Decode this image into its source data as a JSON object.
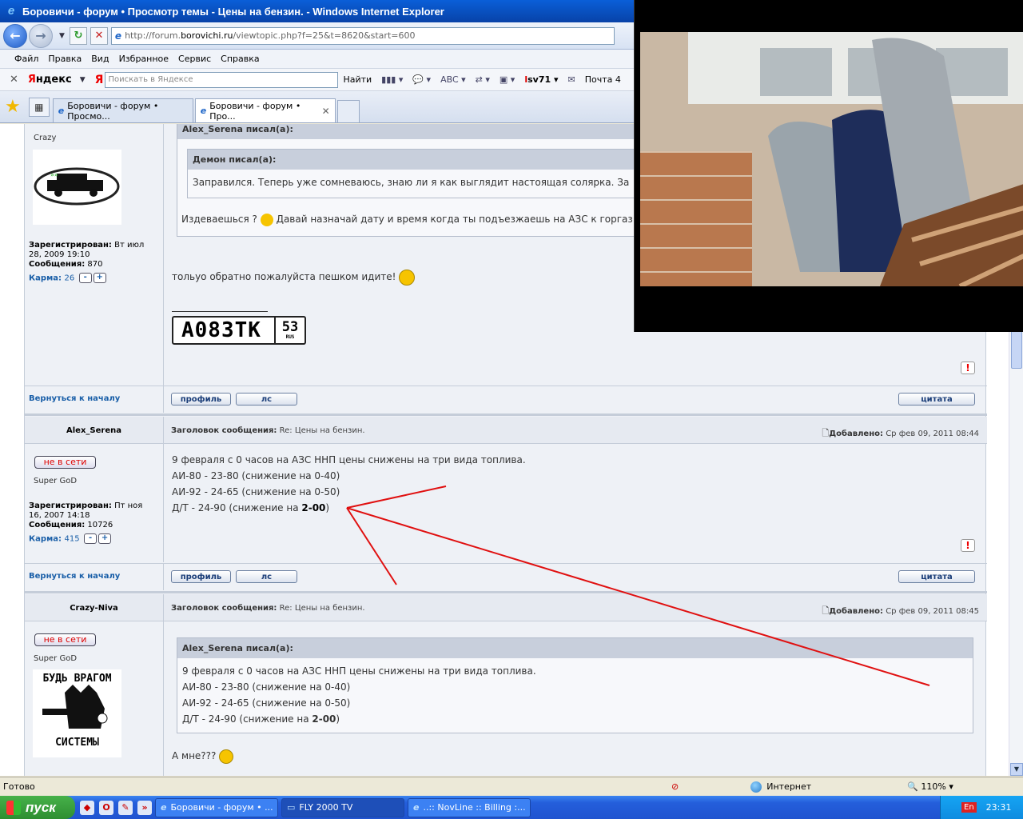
{
  "window": {
    "title": "Боровичи - форум • Просмотр темы - Цены на бензин. - Windows Internet Explorer"
  },
  "address": {
    "prefix": "http://forum.",
    "domain": "borovichi.ru",
    "path": "/viewtopic.php?f=25&t=8620&start=600"
  },
  "menu": [
    "Файл",
    "Правка",
    "Вид",
    "Избранное",
    "Сервис",
    "Справка"
  ],
  "yandex": {
    "logo_y": "Я",
    "logo_rest": "ндекс",
    "search_placeholder": "Поискать в Яндексе",
    "find_label": "Найти",
    "user_first": "l",
    "user_rest": "sv71",
    "mail_label": "Почта 4"
  },
  "tabs": [
    {
      "label": "Боровичи - форум • Просмо..."
    },
    {
      "label": "Боровичи - форум • Про..."
    }
  ],
  "posts": [
    {
      "rank": "Crazy",
      "registered_label": "Зарегистрирован:",
      "registered": "Вт июл 28, 2009 19:10",
      "messages_label": "Сообщения:",
      "messages": "870",
      "karma_label": "Карма:",
      "karma": "26",
      "outer_quote_head": "Alex_Serena писал(а):",
      "inner_quote_head": "Демон писал(а):",
      "inner_quote_text": "Заправился. Теперь уже сомневаюсь, знаю ли я как выглядит настоящая солярка. За",
      "outer_quote_text_a": "Издеваешься ?",
      "outer_quote_text_b": "Давай назначай дату и время когда ты подъезжаешь на АЗС к горгаз",
      "body": "тольуо обратно пожалуйста пешком идите!",
      "plate_main": "А083ТК",
      "plate_region": "53",
      "plate_rus": "RUS"
    },
    {
      "author": "Alex_Serena",
      "subject_label": "Заголовок сообщения:",
      "subject": "Re: Цены на бензин.",
      "posted_label": "Добавлено:",
      "posted": "Ср фев 09, 2011 08:44",
      "status": "не в сети",
      "rank": "Super GoD",
      "registered_label": "Зарегистрирован:",
      "registered": "Пт ноя 16, 2007 14:18",
      "messages_label": "Сообщения:",
      "messages": "10726",
      "karma_label": "Карма:",
      "karma": "415",
      "lines": [
        "9 февраля с 0 часов на АЗС ННП цены снижены на три вида топлива.",
        "АИ-80 - 23-80 (снижение на 0-40)",
        "АИ-92 - 24-65 (снижение на 0-50)"
      ],
      "line4_a": "Д/Т - 24-90 (снижение на ",
      "line4_b": "2-00",
      "line4_c": ")"
    },
    {
      "author": "Crazy-Niva",
      "subject_label": "Заголовок сообщения:",
      "subject": "Re: Цены на бензин.",
      "posted_label": "Добавлено:",
      "posted": "Ср фев 09, 2011 08:45",
      "status": "не в сети",
      "rank": "Super GoD",
      "avatar_top": "БУДЬ ВРАГОМ",
      "avatar_bottom": "СИСТЕМЫ",
      "quote_head": "Alex_Serena писал(а):",
      "body": "А мне???"
    }
  ],
  "common": {
    "back_to_top": "Вернуться к началу",
    "profile": "профиль",
    "pm": "лс",
    "quote": "цитата",
    "report": "!"
  },
  "status": {
    "ready": "Готово",
    "zone": "Интернет",
    "zoom": "110%"
  },
  "taskbar": {
    "start": "пуск",
    "tasks": [
      "Боровичи - форум • ...",
      "FLY 2000 TV",
      "..:: NovLine :: Billing :..."
    ],
    "lang": "En",
    "time": "23:31"
  },
  "colors": {
    "arrow": "#e01010",
    "link": "#1a5fa8",
    "offline": "#dd0000"
  }
}
